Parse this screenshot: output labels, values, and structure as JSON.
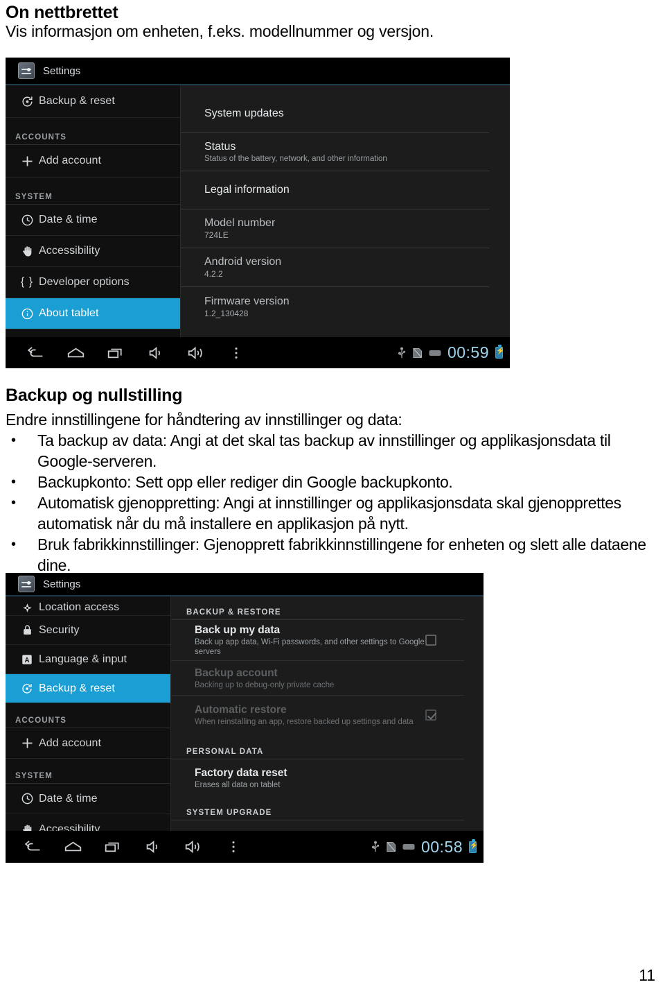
{
  "document": {
    "heading": "On nettbrettet",
    "subheading": "Vis informasjon om enheten, f.eks. modellnummer og versjon.",
    "section_heading": "Backup og nullstilling",
    "section_lead": "Endre innstillingene for håndtering av innstillinger og data:",
    "bullet_marker": "•",
    "bullets": [
      "Ta backup av data: Angi at det skal tas backup av innstillinger og applikasjonsdata til Google-serveren.",
      "Backupkonto: Sett opp eller rediger din Google backupkonto.",
      "Automatisk gjenoppretting: Angi at innstillinger og applikasjonsdata skal gjenopprettes automatisk når du må installere en applikasjon på nytt.",
      "Bruk fabrikkinnstillinger: Gjenopprett fabrikkinnstillingene for enheten og slett alle dataene dine."
    ],
    "page_number": "11"
  },
  "screenshot_about": {
    "actionbar": {
      "title": "Settings",
      "icon": "settings-app-icon"
    },
    "sidebar": [
      {
        "type": "item",
        "icon": "backup-reset-icon",
        "label": "Backup & reset",
        "selected": false
      },
      {
        "type": "header",
        "label": "ACCOUNTS"
      },
      {
        "type": "item",
        "icon": "plus-icon",
        "label": "Add account",
        "selected": false
      },
      {
        "type": "header",
        "label": "SYSTEM"
      },
      {
        "type": "item",
        "icon": "clock-icon",
        "label": "Date & time",
        "selected": false
      },
      {
        "type": "item",
        "icon": "hand-accessibility-icon",
        "label": "Accessibility",
        "selected": false
      },
      {
        "type": "item",
        "icon": "braces-icon",
        "label": "Developer options",
        "selected": false
      },
      {
        "type": "item",
        "icon": "info-circle-icon",
        "label": "About tablet",
        "selected": true
      }
    ],
    "detail": [
      {
        "title": "System updates",
        "sub": "",
        "value": ""
      },
      {
        "title": "Status",
        "sub": "Status of the battery, network, and other information",
        "value": ""
      },
      {
        "title": "Legal information",
        "sub": "",
        "value": ""
      },
      {
        "title": "Model number",
        "sub": "",
        "value": "724LE"
      },
      {
        "title": "Android version",
        "sub": "",
        "value": "4.2.2"
      },
      {
        "title": "Firmware version",
        "sub": "",
        "value": "1.2_130428"
      }
    ],
    "systembar": {
      "buttons": [
        "back-icon",
        "home-icon",
        "recents-icon",
        "volume-down-icon",
        "volume-up-icon",
        "overflow-menu-icon"
      ],
      "status_icons": [
        "usb-icon",
        "sdcard-icon",
        "keyboard-icon"
      ],
      "clock": "00:59",
      "battery": "battery-charging-icon"
    }
  },
  "screenshot_backup": {
    "actionbar": {
      "title": "Settings",
      "icon": "settings-app-icon"
    },
    "sidebar": [
      {
        "type": "item",
        "icon": "location-icon",
        "label": "Location access",
        "selected": false,
        "clipped": true
      },
      {
        "type": "item",
        "icon": "lock-icon",
        "label": "Security",
        "selected": false
      },
      {
        "type": "item",
        "icon": "language-input-icon",
        "label": "Language & input",
        "selected": false
      },
      {
        "type": "item",
        "icon": "backup-reset-icon",
        "label": "Backup & reset",
        "selected": true
      },
      {
        "type": "header",
        "label": "ACCOUNTS"
      },
      {
        "type": "item",
        "icon": "plus-icon",
        "label": "Add account",
        "selected": false
      },
      {
        "type": "header",
        "label": "SYSTEM"
      },
      {
        "type": "item",
        "icon": "clock-icon",
        "label": "Date & time",
        "selected": false
      },
      {
        "type": "item",
        "icon": "hand-accessibility-icon",
        "label": "Accessibility",
        "selected": false
      }
    ],
    "detail": {
      "group1_header": "BACKUP & RESTORE",
      "rows1": [
        {
          "title": "Back up my data",
          "sub": "Back up app data, Wi-Fi passwords, and other settings to Google servers",
          "checkbox": "unchecked",
          "dim": false
        },
        {
          "title": "Backup account",
          "sub": "Backing up to debug-only private cache",
          "checkbox": "none",
          "dim": true
        },
        {
          "title": "Automatic restore",
          "sub": "When reinstalling an app, restore backed up settings and data",
          "checkbox": "checked",
          "dim": true
        }
      ],
      "group2_header": "PERSONAL DATA",
      "rows2": [
        {
          "title": "Factory data reset",
          "sub": "Erases all data on tablet",
          "checkbox": "none",
          "dim": false
        }
      ],
      "group3_header": "SYSTEM UPGRADE"
    },
    "systembar": {
      "buttons": [
        "back-icon",
        "home-icon",
        "recents-icon",
        "volume-down-icon",
        "volume-up-icon",
        "overflow-menu-icon"
      ],
      "status_icons": [
        "usb-icon",
        "sdcard-icon",
        "keyboard-icon"
      ],
      "clock": "00:58",
      "battery": "battery-charging-icon"
    }
  },
  "colors": {
    "selection_blue": "#1a9ed4",
    "clock_blue": "#9fd4ec",
    "panel_left_bg": "#101010",
    "panel_right_bg": "#1c1c1c"
  }
}
